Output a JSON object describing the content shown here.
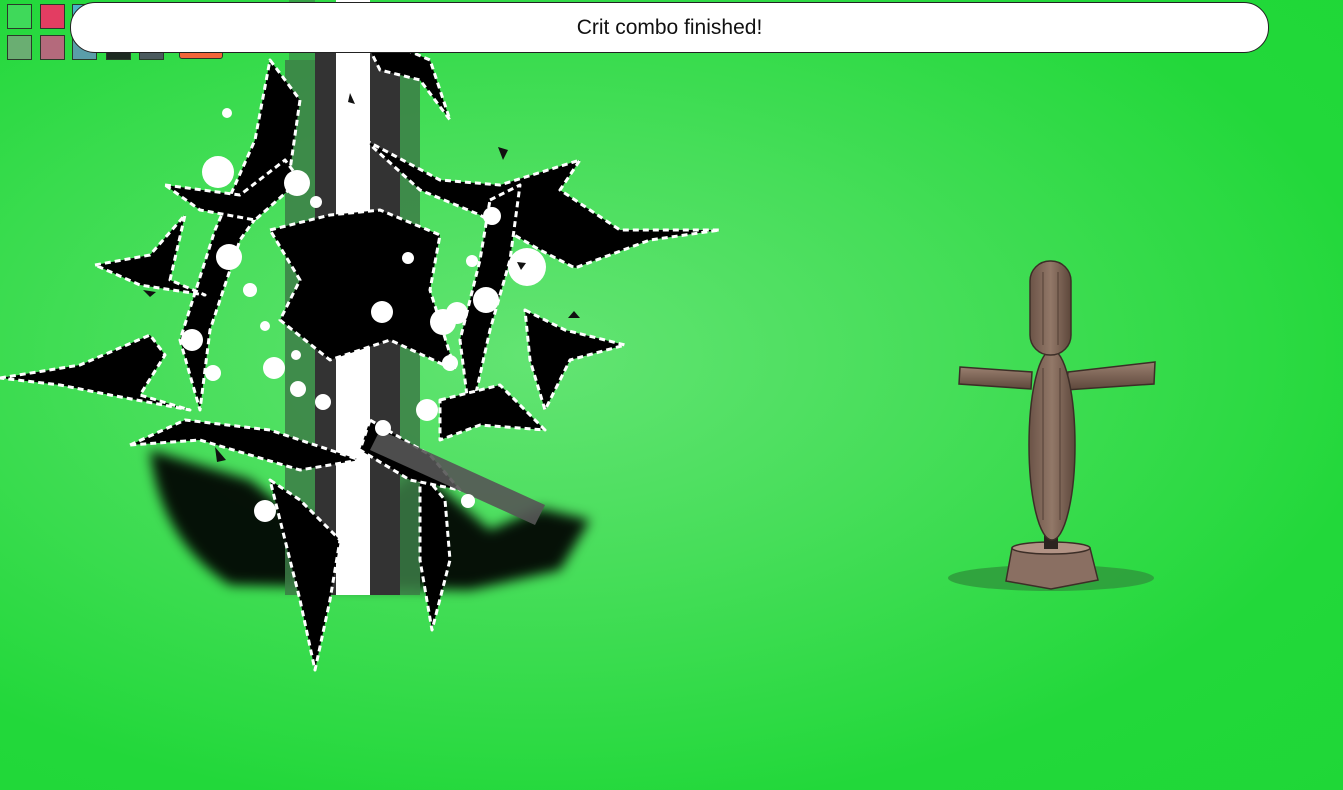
{
  "toast": {
    "message": "Crit combo finished!"
  },
  "palette": {
    "swatches": [
      {
        "name": "green",
        "color": "#3fd95a"
      },
      {
        "name": "red",
        "color": "#e33d62"
      },
      {
        "name": "blue",
        "color": "#4bb3c8"
      },
      {
        "name": "muted-green",
        "color": "#6aae72"
      },
      {
        "name": "muted-red",
        "color": "#b46a7c"
      },
      {
        "name": "muted-blue",
        "color": "#5a9ea9"
      },
      {
        "name": "dark",
        "color": "#1e2a22"
      },
      {
        "name": "slate",
        "color": "#4b5a5e"
      },
      {
        "name": "orange",
        "color": "#f2653a"
      }
    ]
  },
  "scene": {
    "background_color": "#29d942",
    "effect": "crit-burst-black-white",
    "target": "wooden-training-dummy"
  }
}
